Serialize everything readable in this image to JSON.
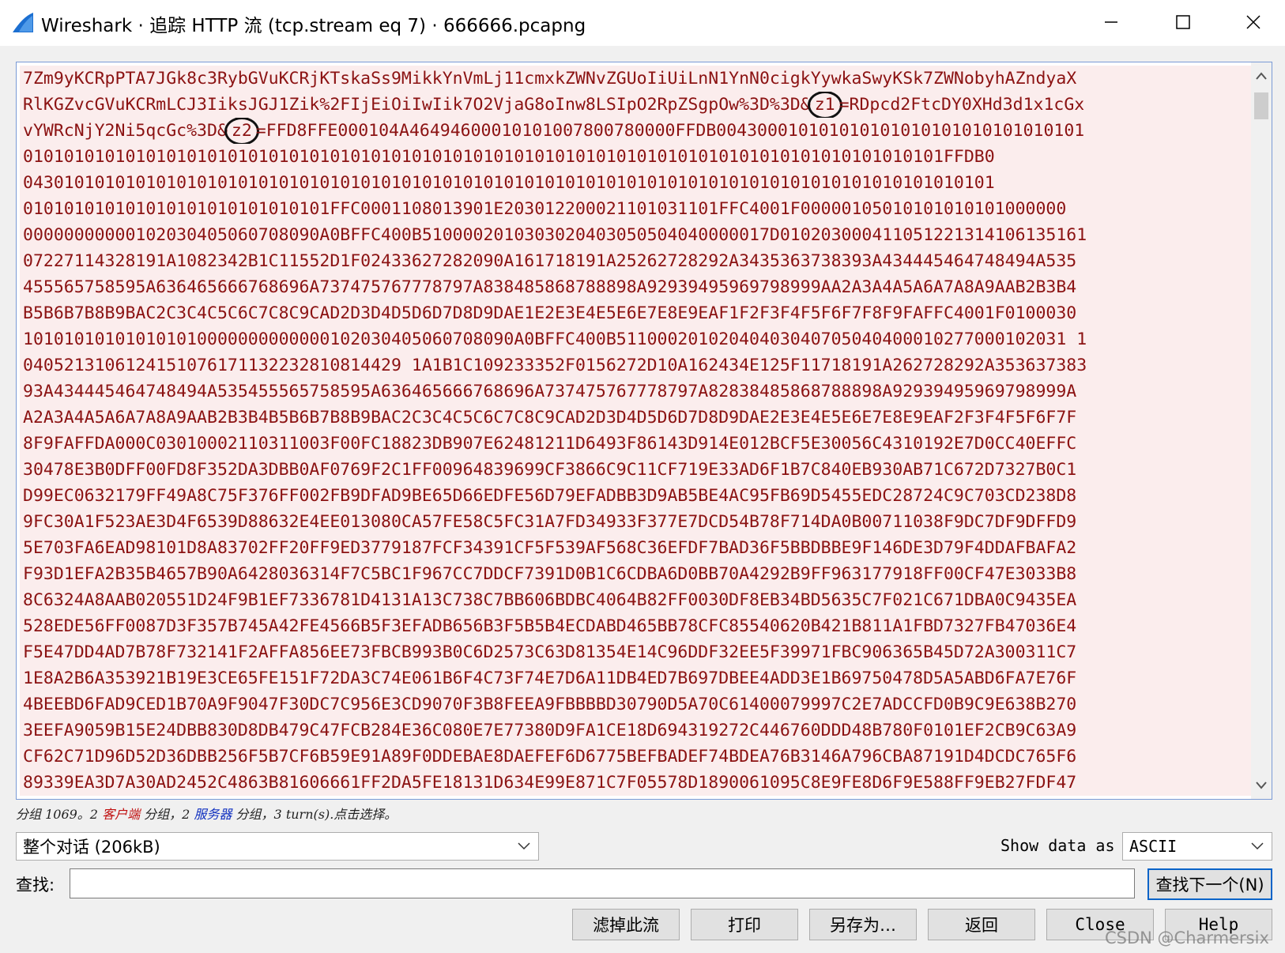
{
  "window": {
    "title": "Wireshark · 追踪 HTTP 流 (tcp.stream eq 7) · 666666.pcapng",
    "minimize_glyph": "—",
    "maximize_glyph": "☐",
    "close_glyph": "✕"
  },
  "stream": {
    "lines": [
      "7Zm9yKCRpPTA7JGk8c3RybGVuKCRjKTskaSs9MikkYnVmLj11cmxkZWNvZGUoIiUiLnN1YnN0cigkYywkaSwyKSk7ZWNobyhAZndyaX",
      "RlKGZvcGVuKCRmLCJ3IiksJGJ1Zik%2FIjEiOiIwIik7O2VjaG8oInw8LSIpO2RpZSgpOw%3D%3D&",
      "vYWRcNjY2Ni5qcGc%3D&",
      "010101010101010101010101010101010101010101010101010101010101010101010101010101010101010101FFDB0",
      "04301010101010101010101010101010101010101010101010101010101010101010101010101010101010101010101",
      "010101010101010101010101010101FFC0001108013901E203012200021101031101FFC4001F00000105010101010101000000",
      "00000000000102030405060708090A0BFFC400B5100002010303020403050504040000017D010203000411051221314106135161",
      "07227114328191A1082342B1C11552D1F02433627282090A161718191A25262728292A3435363738393A434445464748494A535",
      "455565758595A636465666768696A737475767778797A838485868788898A92939495969798999AA2A3A4A5A6A7A8A9AAB2B3B4",
      "B5B6B7B8B9BAC2C3C4C5C6C7C8C9CAD2D3D4D5D6D7D8D9DAE1E2E3E4E5E6E7E8E9EAF1F2F3F4F5F6F7F8F9FAFFC4001F0100030",
      "101010101010101010000000000000102030405060708090A0BFFC400B51100020102040403040705040400010277000102031 1",
      "0405213106124151076171132232810814429 1A1B1C109233352F0156272D10A162434E125F11718191A262728292A353637383",
      "93A434445464748494A535455565758595A636465666768696A737475767778797A82838485868788898A92939495969798999A",
      "A2A3A4A5A6A7A8A9AAB2B3B4B5B6B7B8B9BAC2C3C4C5C6C7C8C9CAD2D3D4D5D6D7D8D9DAE2E3E4E5E6E7E8E9EAF2F3F4F5F6F7F",
      "8F9FAFFDA000C03010002110311003F00FC18823DB907E62481211D6493F86143D914E012BCF5E30056C4310192E7D0CC40EFFC",
      "30478E3B0DFF00FD8F352DA3DBB0AF0769F2C1FF00964839699CF3866C9C11CF719E33AD6F1B7C840EB930AB71C672D7327B0C1",
      "D99EC0632179FF49A8C75F376FF002FB9DFAD9BE65D66EDFE56D79EFADBB3D9AB5BE4AC95FB69D5455EDC28724C9C703CD238D8",
      "9FC30A1F523AE3D4F6539D88632E4EE013080CA57FE58C5FC31A7FD34933F377E7DCD54B78F714DA0B00711038F9DC7DF9DFFD9",
      "5E703FA6EAD98101D8A83702FF20FF9ED3779187FCF34391CF5F539AF568C36EFDF7BAD36F5BBDBBE9F146DE3D79F4DDAFBAFA2",
      "F93D1EFA2B35B4657B90A6428036314F7C5BC1F967CC7DDCF7391D0B1C6CDBA6D0BB70A4292B9FF963177918FF00CF47E3033B8",
      "8C6324A8AAB020551D24F9B1EF7336781D4131A13C738C7BB606BDBC4064B82FF0030DF8EB34BD5635C7F021C671DBA0C9435EA",
      "528EDE56FF0087D3F357B745A42FE4566B5F3EFADB656B3F5B5B4ECDABD465BB78CFC85540620B421B811A1FBD7327FB47036E4",
      "F5E47DD4AD7B78F732141F2AFFA856EE73FBCB993B0C6D2573C63D81354E14C96DDF32EE5F39971FBC906365B45D72A300311C7",
      "1E8A2B6A353921B19E3CE65FE151F72DA3C74E061B6F4C73F74E7D6A11DB4ED7B697DBEE4ADD3E1B69750478D5A5ABD6FA7E76F",
      "4BEEBD6FAD9CED1B70A9F9047F30DC7C956E3CD9070F3B8FEEA9FBBBBD30790D5A70C61400079997C2E7ADCCFD0B9C9E638B270",
      "3EEFA9059B15E24DBB830D8DB479C47FCB284E36C080E7E77380D9FA1CE18D694319272C446760DDD48B780F0101EF2CB9C63A9",
      "CF62C71D96D52D36DBB256F5B7CF6B59E91A89F0DDEBAE8DAEFEF6D6775BEFBADEF74BDEA76B3146A796CBA87191D4DCDC765F6",
      "89339EA3D7A30AD2452C4863B81606661FF2DA5FE18131D634E99E871C7F05578D1890061095C8E9FE8D6F9E588FF9EB27FDF47"
    ],
    "z1_label": "z1",
    "z1_rest": "=RDpcd2FtcDY0XHd3d1x1cGx",
    "z2_label": "z2",
    "z2_rest": "=FFD8FFE000104A46494600010101007800780000FFDB004300010101010101010101010101010101"
  },
  "status": {
    "prefix": "分组 1069。2 ",
    "client": "客户端",
    "mid": " 分组，2 ",
    "server": "服务器",
    "suffix": " 分组，3 turn(s).点击选择。"
  },
  "conversation_select": {
    "value": "整个对话 (206kB)"
  },
  "show_data": {
    "label": "Show data as",
    "value": "ASCII"
  },
  "find": {
    "label": "查找:",
    "value": "",
    "next_label": "查找下一个(N)"
  },
  "buttons": {
    "filter": "滤掉此流",
    "print": "打印",
    "save_as": "另存为…",
    "back": "返回",
    "close": "Close",
    "help": "Help"
  },
  "watermark": "CSDN @Charmersix"
}
